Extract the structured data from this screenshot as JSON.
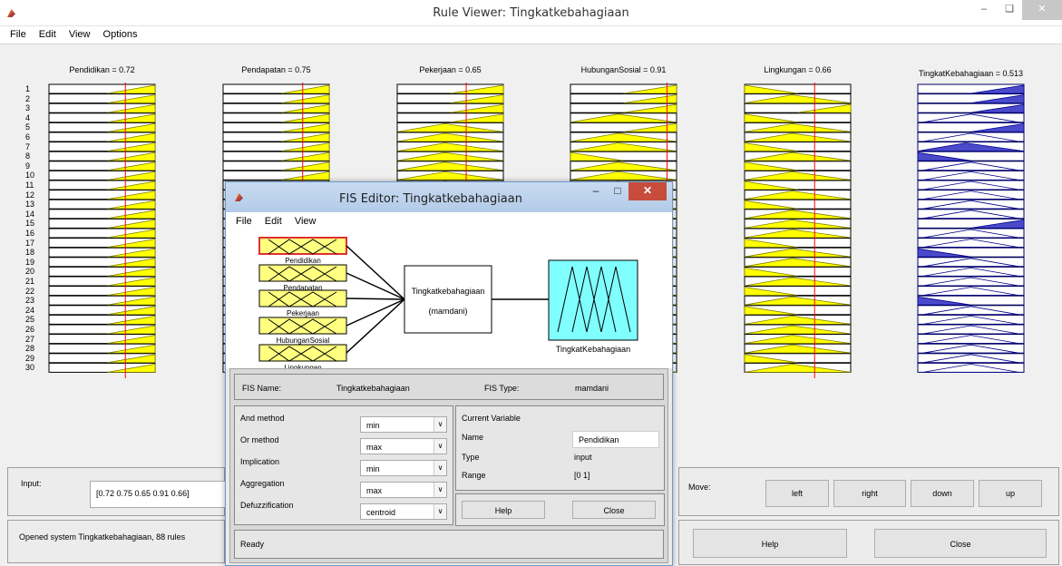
{
  "window": {
    "title": "Rule Viewer: Tingkatkebahagiaan"
  },
  "menu": [
    "File",
    "Edit",
    "View",
    "Options"
  ],
  "columns": [
    {
      "title": "Pendidikan = 0.72",
      "value": 0.72,
      "shapes": [
        "rr",
        "rr",
        "rr",
        "rr",
        "rr",
        "rr",
        "rr",
        "rr",
        "rr",
        "rr",
        "rr",
        "rr",
        "rr",
        "rr",
        "rr",
        "rr",
        "rr",
        "rr",
        "rr",
        "rr",
        "rr",
        "rr",
        "rr",
        "rr",
        "rr",
        "rr",
        "rr",
        "rr",
        "rr",
        "rr"
      ]
    },
    {
      "title": "Pendapatan = 0.75",
      "value": 0.75,
      "shapes": [
        "rr",
        "rr",
        "rr",
        "rr",
        "rr",
        "rr",
        "rr",
        "rr",
        "rr",
        "rr",
        "rr",
        "rr",
        "rr",
        "rr",
        "rr",
        "rr",
        "rr",
        "rr",
        "rr",
        "rr",
        "rr",
        "rr",
        "rr",
        "rr",
        "rr",
        "rr",
        "rr",
        "rr",
        "rr",
        "rr"
      ]
    },
    {
      "title": "Pekerjaan = 0.65",
      "value": 0.65,
      "shapes": [
        "r",
        "r",
        "r",
        "r",
        "t",
        "t",
        "t",
        "t",
        "t",
        "t",
        "t",
        "t",
        "t",
        "t",
        "t",
        "t",
        "t",
        "t",
        "t",
        "t",
        "t",
        "t",
        "t",
        "t",
        "t",
        "t",
        "t",
        "t",
        "t",
        "t"
      ]
    },
    {
      "title": "HubunganSosial = 0.91",
      "value": 0.91,
      "shapes": [
        "r",
        "r",
        "r",
        "t",
        "r",
        "t",
        "t",
        "l",
        "t",
        "t",
        "t",
        "t",
        "t",
        "t",
        "t",
        "t",
        "t",
        "t",
        "t",
        "t",
        "t",
        "t",
        "t",
        "t",
        "t",
        "t",
        "t",
        "t",
        "t",
        "t"
      ]
    },
    {
      "title": "Lingkungan = 0.66",
      "value": 0.66,
      "shapes": [
        "l",
        "t",
        "r",
        "l",
        "t",
        "t",
        "l",
        "t",
        "l",
        "t",
        "l",
        "t",
        "l",
        "t",
        "t",
        "t",
        "l",
        "t",
        "t",
        "l",
        "t",
        "l",
        "t",
        "l",
        "t",
        "t",
        "t",
        "t",
        "l",
        "t"
      ]
    },
    {
      "title": "TingkatKebahagiaan = 0.513",
      "value": 0.513,
      "shapes": [
        "r",
        "r",
        "r",
        "m",
        "r",
        "m",
        "t",
        "l",
        "m",
        "m",
        "m",
        "m",
        "m",
        "m",
        "r",
        "m",
        "m",
        "l",
        "m",
        "m",
        "m",
        "m",
        "l",
        "m",
        "m",
        "m",
        "m",
        "m",
        "m",
        "m"
      ]
    }
  ],
  "rows": [
    "1",
    "2",
    "3",
    "4",
    "5",
    "6",
    "7",
    "8",
    "9",
    "10",
    "11",
    "12",
    "13",
    "14",
    "15",
    "16",
    "17",
    "18",
    "19",
    "20",
    "21",
    "22",
    "23",
    "24",
    "25",
    "26",
    "27",
    "28",
    "29",
    "30"
  ],
  "input": {
    "label": "Input:",
    "value": "[0.72 0.75 0.65 0.91 0.66]"
  },
  "status": "Opened system Tingkatkebahagiaan, 88 rules",
  "move": {
    "label": "Move:",
    "left": "left",
    "right": "right",
    "down": "down",
    "up": "up"
  },
  "bottom_buttons": {
    "help": "Help",
    "close": "Close"
  },
  "fis": {
    "title": "FIS Editor: Tingkatkebahagiaan",
    "menu": [
      "File",
      "Edit",
      "View"
    ],
    "inputs": [
      "Pendidikan",
      "Pendapatan",
      "Pekerjaan",
      "HubunganSosial",
      "Lingkungan"
    ],
    "system_name": "Tingkatkebahagiaan",
    "system_type": "(mamdani)",
    "output_name": "TingkatKebahagiaan",
    "fis_name_label": "FIS Name:",
    "fis_name": "Tingkatkebahagiaan",
    "fis_type_label": "FIS Type:",
    "fis_type": "mamdani",
    "methods": [
      {
        "label": "And method",
        "value": "min"
      },
      {
        "label": "Or method",
        "value": "max"
      },
      {
        "label": "Implication",
        "value": "min"
      },
      {
        "label": "Aggregation",
        "value": "max"
      },
      {
        "label": "Defuzzification",
        "value": "centroid"
      }
    ],
    "current_variable": {
      "header": "Current Variable",
      "name_label": "Name",
      "name": "Pendidikan",
      "type_label": "Type",
      "type": "input",
      "range_label": "Range",
      "range": "[0 1]"
    },
    "help": "Help",
    "close": "Close",
    "status": "Ready"
  }
}
